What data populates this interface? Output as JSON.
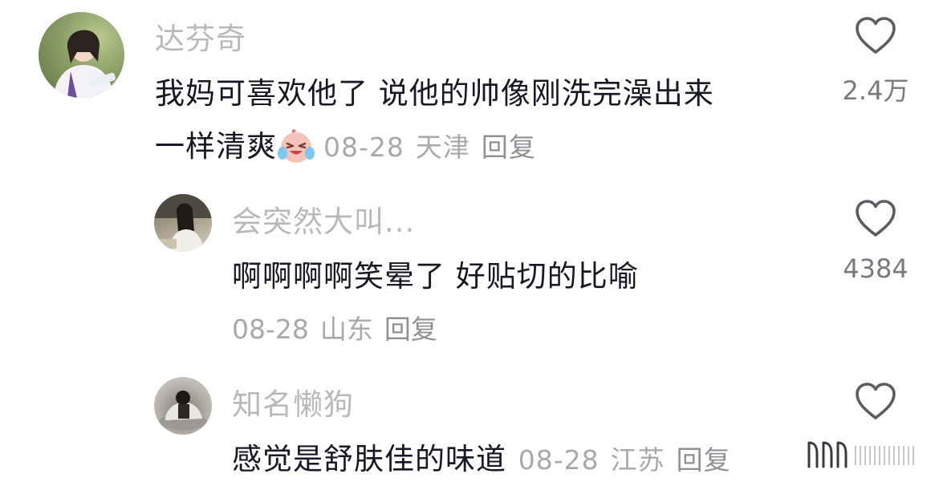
{
  "comments": [
    {
      "username": "达芬奇",
      "text_line1": "我妈可喜欢他了 说他的帅像刚洗完澡出来",
      "text_line2": "一样清爽",
      "emoji": "crying-laughing-emoji",
      "date": "08-28",
      "location": "天津",
      "reply_label": "回复",
      "likes": "2.4万"
    },
    {
      "username": "会突然大叫...",
      "text": "啊啊啊啊笑晕了 好贴切的比喻",
      "date": "08-28",
      "location": "山东",
      "reply_label": "回复",
      "likes": "4384"
    },
    {
      "username": "知名懒狗",
      "text": "感觉是舒肤佳的味道",
      "date": "08-28",
      "location": "江苏",
      "reply_label": "回复"
    }
  ],
  "icons": {
    "like": "heart-outline-icon"
  },
  "colors": {
    "username": "#b8b9bd",
    "text": "#161823",
    "meta": "#a8a9ad",
    "icon": "#5b5d63"
  }
}
